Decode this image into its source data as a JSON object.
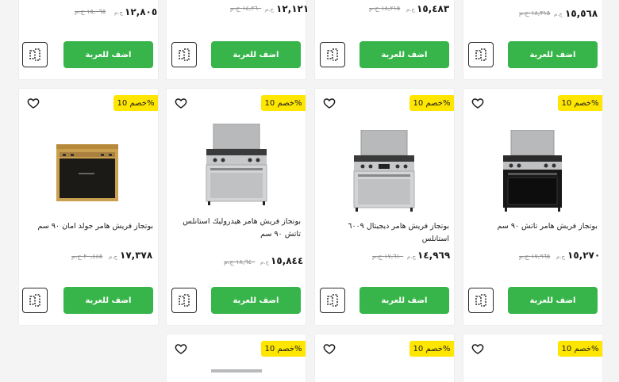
{
  "currency": "ج.م",
  "add_label": "اضف للعربة",
  "discount_label": "خصم 10%",
  "top_row": [
    {
      "price": "١٢,٨٠٥",
      "old_price": "١٥,٠٦٥ ج.م"
    },
    {
      "price": "١٢,١٢١",
      "old_price": "١٤,٢٦٠ ج.م"
    },
    {
      "price": "١٥,٤٨٣",
      "old_price": "١٨,٢١٥ ج.م"
    },
    {
      "price": "١٥,٥٦٨",
      "old_price": "١٨,٣١٥ ج.م"
    }
  ],
  "mid_row": [
    {
      "name": "بوتجاز فريش هامر جولد امان ٩٠ سم",
      "price": "١٧,٣٧٨",
      "old_price": "٢٠,٤٤٥ ج.م"
    },
    {
      "name": "بوتجاز فريش هامر هيدروليك استانلس تاتش ٩٠ سم",
      "price": "١٥,٨٤٤",
      "old_price": "١٨,٦٤٠ ج.م"
    },
    {
      "name": "بوتجاز فريش هامر ديجيتال ٦٠٠٩ استانلس",
      "price": "١٤,٩٦٩",
      "old_price": "١٧,٦١٠ ج.م"
    },
    {
      "name": "بوتجاز فريش هامر تاتش ٩٠ سم",
      "price": "١٥,٢٧٠",
      "old_price": "١٧,٩٦٥ ج.م"
    }
  ]
}
